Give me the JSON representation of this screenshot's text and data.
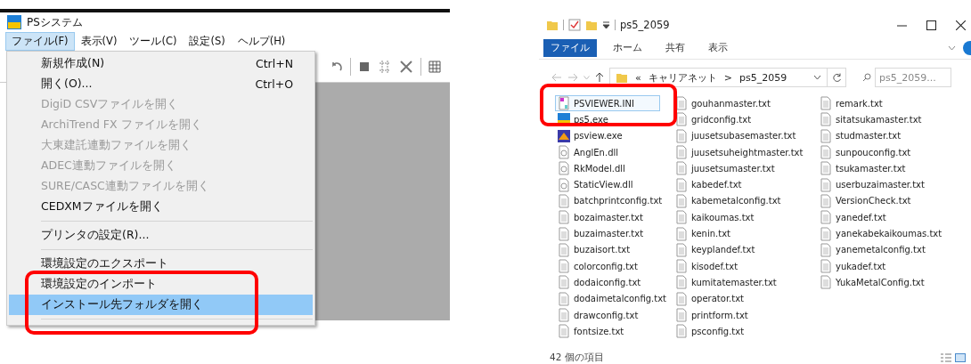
{
  "app": {
    "title": "PSシステム",
    "menubar": [
      {
        "label": "ファイル(F)",
        "selected": true
      },
      {
        "label": "表示(V)",
        "selected": false
      },
      {
        "label": "ツール(C)",
        "selected": false
      },
      {
        "label": "設定(S)",
        "selected": false
      },
      {
        "label": "ヘルプ(H)",
        "selected": false
      }
    ],
    "file_menu": [
      {
        "kind": "item",
        "label": "新規作成(N)",
        "shortcut": "Ctrl+N",
        "disabled": false,
        "selected": false
      },
      {
        "kind": "item",
        "label": "開く(O)...",
        "shortcut": "Ctrl+O",
        "disabled": false,
        "selected": false
      },
      {
        "kind": "item",
        "label": "DigiD CSVファイルを開く",
        "disabled": true,
        "selected": false
      },
      {
        "kind": "item",
        "label": "ArchiTrend FX ファイルを開く",
        "disabled": true,
        "selected": false
      },
      {
        "kind": "item",
        "label": "大東建託連動ファイルを開く",
        "disabled": true,
        "selected": false
      },
      {
        "kind": "item",
        "label": "ADEC連動ファイルを開く",
        "disabled": true,
        "selected": false
      },
      {
        "kind": "item",
        "label": "SURE/CASC連動ファイルを開く",
        "disabled": true,
        "selected": false
      },
      {
        "kind": "item",
        "label": "CEDXMファイルを開く",
        "disabled": false,
        "selected": false
      },
      {
        "kind": "separator"
      },
      {
        "kind": "item",
        "label": "プリンタの設定(R)...",
        "disabled": false,
        "selected": false
      },
      {
        "kind": "separator"
      },
      {
        "kind": "item",
        "label": "環境設定のエクスポート",
        "disabled": false,
        "selected": false
      },
      {
        "kind": "item",
        "label": "環境設定のインポート",
        "disabled": false,
        "selected": false
      },
      {
        "kind": "item",
        "label": "インストール先フォルダを開く",
        "disabled": false,
        "selected": true
      },
      {
        "kind": "separator"
      }
    ]
  },
  "explorer": {
    "title": "ps5_2059",
    "ribbon_tabs": [
      {
        "label": "ファイル",
        "selected": true
      },
      {
        "label": "ホーム",
        "selected": false
      },
      {
        "label": "共有",
        "selected": false
      },
      {
        "label": "表示",
        "selected": false
      }
    ],
    "address": [
      "«",
      "キャリアネット",
      ">",
      "ps5_2059"
    ],
    "search": {
      "placeholder": "ps5_2059..."
    },
    "files": [
      {
        "name": "PSVIEWER.INI",
        "kind": "ini",
        "selected": true
      },
      {
        "name": "ps5.exe",
        "kind": "exe",
        "selected": false
      },
      {
        "name": "psview.exe",
        "kind": "viewer",
        "selected": false
      },
      {
        "name": "AnglEn.dll",
        "kind": "dll",
        "selected": false
      },
      {
        "name": "RkModel.dll",
        "kind": "dll",
        "selected": false
      },
      {
        "name": "StaticView.dll",
        "kind": "dll",
        "selected": false
      },
      {
        "name": "batchprintconfig.txt",
        "kind": "txt",
        "selected": false
      },
      {
        "name": "bozaimaster.txt",
        "kind": "txt",
        "selected": false
      },
      {
        "name": "buzaimaster.txt",
        "kind": "txt",
        "selected": false
      },
      {
        "name": "buzaisort.txt",
        "kind": "txt",
        "selected": false
      },
      {
        "name": "colorconfig.txt",
        "kind": "txt",
        "selected": false
      },
      {
        "name": "dodaiconfig.txt",
        "kind": "txt",
        "selected": false
      },
      {
        "name": "dodaimetalconfig.txt",
        "kind": "txt",
        "selected": false
      },
      {
        "name": "drawconfig.txt",
        "kind": "txt",
        "selected": false
      },
      {
        "name": "fontsize.txt",
        "kind": "txt",
        "selected": false
      },
      {
        "name": "gouhanmaster.txt",
        "kind": "txt",
        "selected": false
      },
      {
        "name": "gridconfig.txt",
        "kind": "txt",
        "selected": false
      },
      {
        "name": "juusetsubasemaster.txt",
        "kind": "txt",
        "selected": false
      },
      {
        "name": "juusetsuheightmaster.txt",
        "kind": "txt",
        "selected": false
      },
      {
        "name": "juusetsumaster.txt",
        "kind": "txt",
        "selected": false
      },
      {
        "name": "kabedef.txt",
        "kind": "txt",
        "selected": false
      },
      {
        "name": "kabemetalconfig.txt",
        "kind": "txt",
        "selected": false
      },
      {
        "name": "kaikoumas.txt",
        "kind": "txt",
        "selected": false
      },
      {
        "name": "kenin.txt",
        "kind": "txt",
        "selected": false
      },
      {
        "name": "keyplandef.txt",
        "kind": "txt",
        "selected": false
      },
      {
        "name": "kisodef.txt",
        "kind": "txt",
        "selected": false
      },
      {
        "name": "kumitatemaster.txt",
        "kind": "txt",
        "selected": false
      },
      {
        "name": "operator.txt",
        "kind": "txt",
        "selected": false
      },
      {
        "name": "printform.txt",
        "kind": "txt",
        "selected": false
      },
      {
        "name": "psconfig.txt",
        "kind": "txt",
        "selected": false
      },
      {
        "name": "remark.txt",
        "kind": "txt",
        "selected": false
      },
      {
        "name": "sitatsukamaster.txt",
        "kind": "txt",
        "selected": false
      },
      {
        "name": "studmaster.txt",
        "kind": "txt",
        "selected": false
      },
      {
        "name": "sunpouconfig.txt",
        "kind": "txt",
        "selected": false
      },
      {
        "name": "tsukamaster.txt",
        "kind": "txt",
        "selected": false
      },
      {
        "name": "userbuzaimaster.txt",
        "kind": "txt",
        "selected": false
      },
      {
        "name": "VersionCheck.txt",
        "kind": "txt",
        "selected": false
      },
      {
        "name": "yanedef.txt",
        "kind": "txt",
        "selected": false
      },
      {
        "name": "yanekabekaikoumas.txt",
        "kind": "txt",
        "selected": false
      },
      {
        "name": "yanemetalconfig.txt",
        "kind": "txt",
        "selected": false
      },
      {
        "name": "yukadef.txt",
        "kind": "txt",
        "selected": false
      },
      {
        "name": "YukaMetalConfig.txt",
        "kind": "txt",
        "selected": false
      }
    ],
    "status_bar": "42 個の項目"
  }
}
